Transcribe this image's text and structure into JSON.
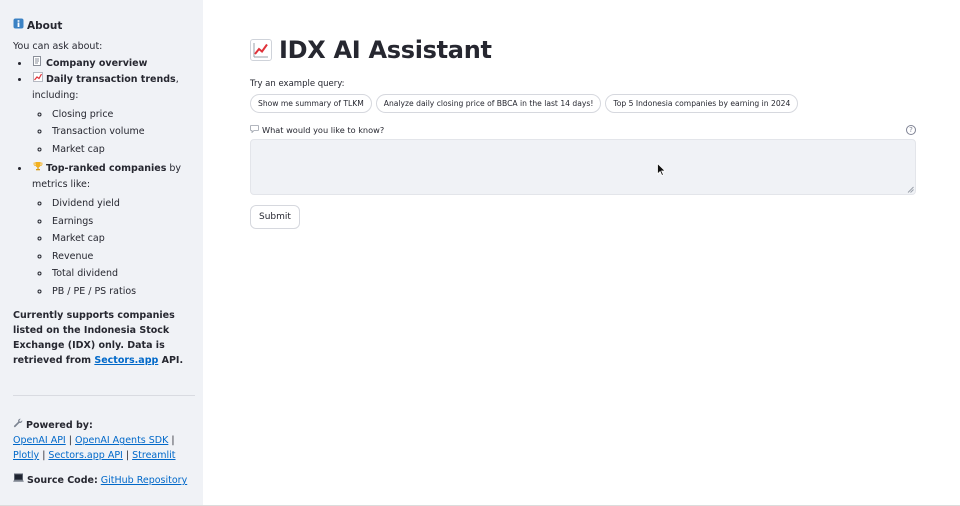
{
  "sidebar": {
    "about_heading": "About",
    "intro": "You can ask about:",
    "items": [
      {
        "icon": "document-icon",
        "label": "Company overview",
        "suffix": ""
      },
      {
        "icon": "chart-up-icon",
        "label": "Daily transaction trends",
        "suffix": ", including:",
        "subitems": [
          "Closing price",
          "Transaction volume",
          "Market cap"
        ]
      },
      {
        "icon": "trophy-icon",
        "label": "Top-ranked companies",
        "suffix": " by metrics like:",
        "subitems": [
          "Dividend yield",
          "Earnings",
          "Market cap",
          "Revenue",
          "Total dividend",
          "PB / PE / PS ratios"
        ]
      }
    ],
    "note_line": "Currently supports companies listed on the Indonesia Stock Exchange (IDX) only. Data is retrieved from ",
    "note_link": "Sectors.app",
    "note_end": " API.",
    "powered_by": "Powered by:",
    "powered_links": [
      "OpenAI API",
      "OpenAI Agents SDK",
      "Plotly",
      "Sectors.app API",
      "Streamlit"
    ],
    "source_label": "Source Code:",
    "source_link": "GitHub Repository"
  },
  "main": {
    "title": "IDX AI Assistant",
    "try_label": "Try an example query:",
    "examples": [
      "Show me summary of TLKM",
      "Analyze daily closing price of BBCA in the last 14 days!",
      "Top 5 Indonesia companies by earning in 2024"
    ],
    "question_label": "What would you like to know?",
    "question_value": "",
    "submit_label": "Submit"
  }
}
